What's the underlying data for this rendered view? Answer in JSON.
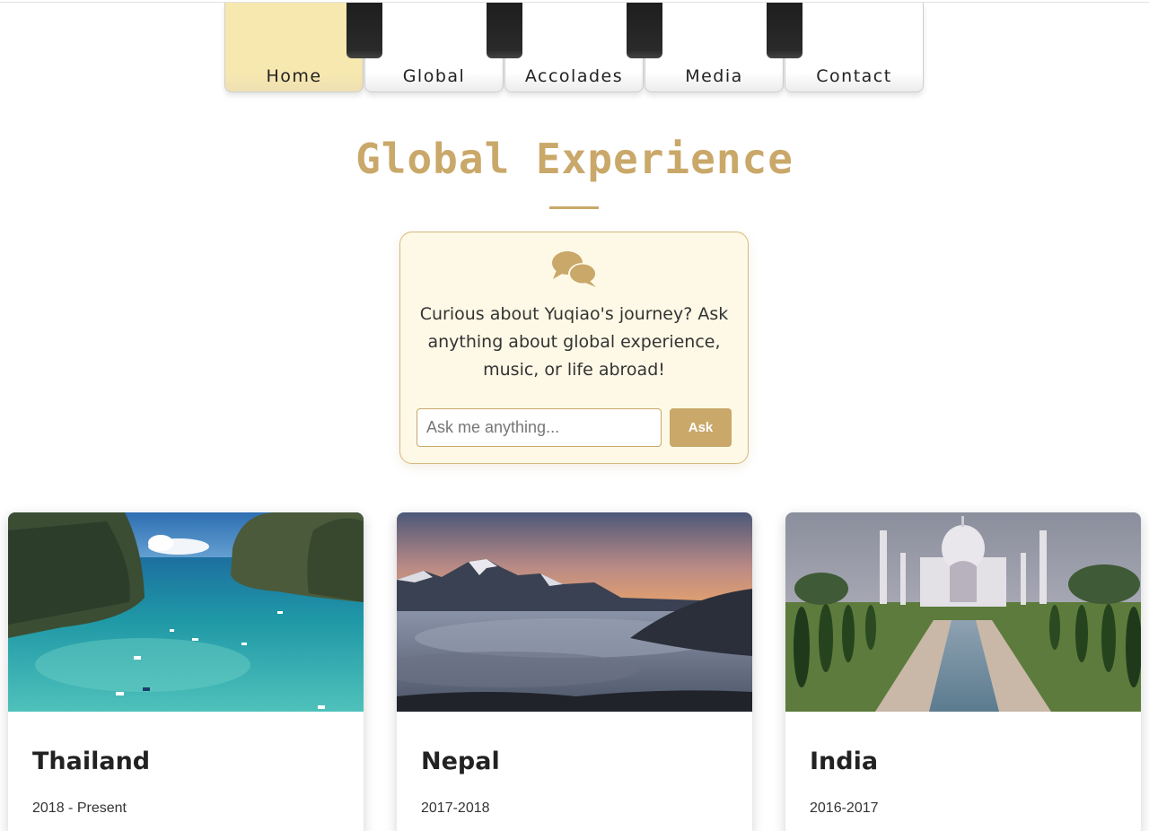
{
  "nav": {
    "items": [
      {
        "label": "Home",
        "active": true
      },
      {
        "label": "Global",
        "active": false
      },
      {
        "label": "Accolades",
        "active": false
      },
      {
        "label": "Media",
        "active": false
      },
      {
        "label": "Contact",
        "active": false
      }
    ]
  },
  "page": {
    "title": "Global Experience"
  },
  "ask": {
    "icon": "chat-bubbles-icon",
    "prompt": "Curious about Yuqiao's journey? Ask anything about global experience, music, or life abroad!",
    "placeholder": "Ask me anything...",
    "value": "",
    "button_label": "Ask"
  },
  "cards": [
    {
      "country": "Thailand",
      "years": "2018 - Present"
    },
    {
      "country": "Nepal",
      "years": "2017-2018"
    },
    {
      "country": "India",
      "years": "2016-2017"
    }
  ],
  "colors": {
    "accent": "#c9a86a",
    "active_key": "#f7e8b0",
    "card_bg": "#fdf9e6",
    "black_key": "#222222"
  }
}
